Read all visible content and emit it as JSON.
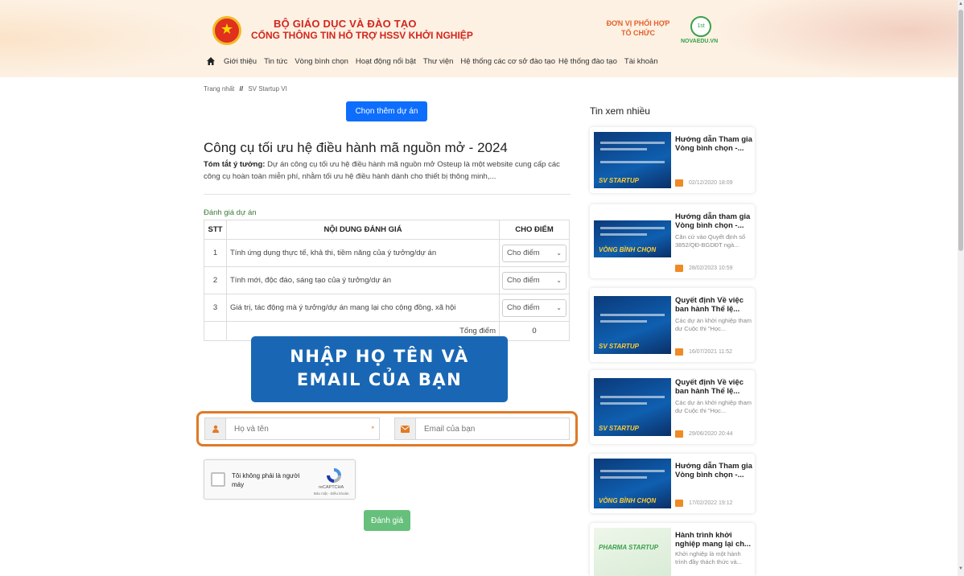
{
  "header": {
    "title_line1": "BỘ GIÁO DỤC VÀ ĐÀO TẠO",
    "title_line2": "CỔNG THÔNG TIN HỖ TRỢ HSSV KHỞI NGHIỆP",
    "partner_label": "ĐƠN VỊ PHỐI HỢP TỔ CHỨC",
    "partner_name": "NOVAEDU.VN",
    "brand_color": "#d2261d"
  },
  "nav": {
    "items": [
      "Giới thiệu",
      "Tin tức",
      "Vòng bình chọn",
      "Hoạt động nổi bật",
      "Thư viện",
      "Hệ thống các cơ sở đào tạo",
      "Hệ thống đào tạo",
      "Tài khoản"
    ]
  },
  "breadcrumb": {
    "home": "Trang nhất",
    "separator": "//",
    "current": "SV Startup VI"
  },
  "main": {
    "more_button": "Chọn thêm dự án",
    "project_title": "Công cụ tối ưu hệ điều hành mã nguồn mở - 2024",
    "summary_label": "Tóm tắt ý tưởng:",
    "summary_text": "Dự án công cụ tối ưu hệ điều hành mã nguồn mở Osteup là một website cung cấp các công cụ hoàn toàn miễn phí, nhằm tối ưu hệ điều hành dành cho thiết bị thông minh,...",
    "eval_label": "Đánh giá dự án",
    "table": {
      "headers": [
        "STT",
        "NỘI DUNG ĐÁNH GIÁ",
        "CHO ĐIỂM"
      ],
      "rows": [
        {
          "stt": "1",
          "content": "Tính ứng dụng thực tế, khả thi, tiềm năng của ý tưởng/dự án",
          "score": "Cho điểm"
        },
        {
          "stt": "2",
          "content": "Tính mới, độc đáo, sáng tạo của ý tưởng/dự án",
          "score": "Cho điểm"
        },
        {
          "stt": "3",
          "content": "Giá trị, tác động mà ý tưởng/dự án mang lại cho cộng đồng, xã hội",
          "score": "Cho điểm"
        }
      ],
      "total_label": "Tổng điểm",
      "total_value": "0"
    },
    "banner_line1": "NHẬP HỌ TÊN VÀ",
    "banner_line2": "EMAIL CỦA BẠN",
    "name_placeholder": "Họ và tên",
    "name_required": "*",
    "email_placeholder": "Email của bạn",
    "recaptcha": {
      "label": "Tôi không phải là người máy",
      "brand": "reCAPTCHA",
      "terms": "Bảo mật - Điều khoản"
    },
    "submit_button": "Đánh giá"
  },
  "sidebar": {
    "title": "Tin xem nhiều",
    "items": [
      {
        "title": "Hướng dẫn Tham gia Vòng bình chọn -...",
        "desc": "",
        "date": "02/12/2020 18:09",
        "thumb_text": "SV STARTUP"
      },
      {
        "title": "Hướng dẫn tham gia Vòng bình chọn -...",
        "desc": "Căn cứ vào Quyết định số 3852/QĐ-BGDĐT ngà...",
        "date": "28/02/2023 10:59",
        "thumb_text": "VÒNG BÌNH CHỌN"
      },
      {
        "title": "Quyết định Về việc ban hành Thể lệ...",
        "desc": "Các dự án khởi nghiệp tham dự Cuộc thi \"Học...",
        "date": "16/07/2021 11:52",
        "thumb_text": "SV STARTUP"
      },
      {
        "title": "Quyết định Về việc ban hành Thể lệ...",
        "desc": "Các dự án khởi nghiệp tham dự Cuộc thi \"Học...",
        "date": "29/06/2020 20:44",
        "thumb_text": "SV STARTUP"
      },
      {
        "title": "Hướng dẫn Tham gia Vòng bình chọn -...",
        "desc": "",
        "date": "17/02/2022 19:12",
        "thumb_text": "VÒNG BÌNH CHỌN"
      },
      {
        "title": "Hành trình khởi nghiệp mang lại ch...",
        "desc": "Khởi nghiệp là một hành trình đầy thách thức và...",
        "date": "",
        "thumb_text": "PHARMA STARTUP"
      }
    ]
  }
}
